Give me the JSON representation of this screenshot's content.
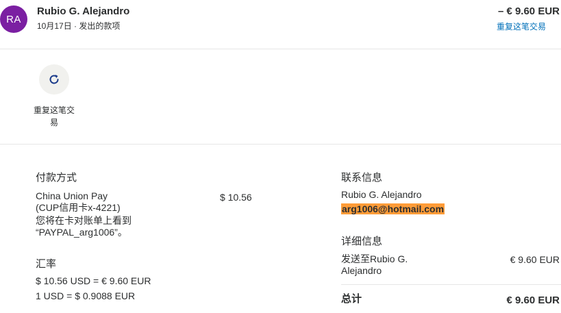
{
  "header": {
    "avatar_initials": "RA",
    "avatar_color": "#7b1fa2",
    "name": "Rubio G. Alejandro",
    "date": "10月17日",
    "separator": "·",
    "type": "发出的款项",
    "amount": "– € 9.60 EUR",
    "repeat_link": "重复这笔交易"
  },
  "actions": {
    "repeat_label": "重复这笔交易",
    "icon": "refresh-icon"
  },
  "payment": {
    "title": "付款方式",
    "method_line1": "China Union Pay",
    "method_line2": "(CUP信用卡x-4221)",
    "method_line3": "您将在卡对账单上看到",
    "method_line4": "“PAYPAL_arg1006”。",
    "method_amount": "$ 10.56"
  },
  "exchange": {
    "title": "汇率",
    "line1": "$ 10.56 USD = € 9.60 EUR",
    "line2": "1 USD = $ 0.9088 EUR"
  },
  "contact": {
    "title": "联系信息",
    "name": "Rubio G. Alejandro",
    "email": "arg1006@hotmail.com"
  },
  "details": {
    "title": "详细信息",
    "sent_to_line1": "发送至Rubio G.",
    "sent_to_line2": "Alejandro",
    "sent_amount": "€ 9.60 EUR",
    "total_label": "总计",
    "total_amount": "€ 9.60 EUR"
  },
  "colors": {
    "link": "#0070ba",
    "highlight": "#ff9c38",
    "icon": "#1a3a8a"
  }
}
